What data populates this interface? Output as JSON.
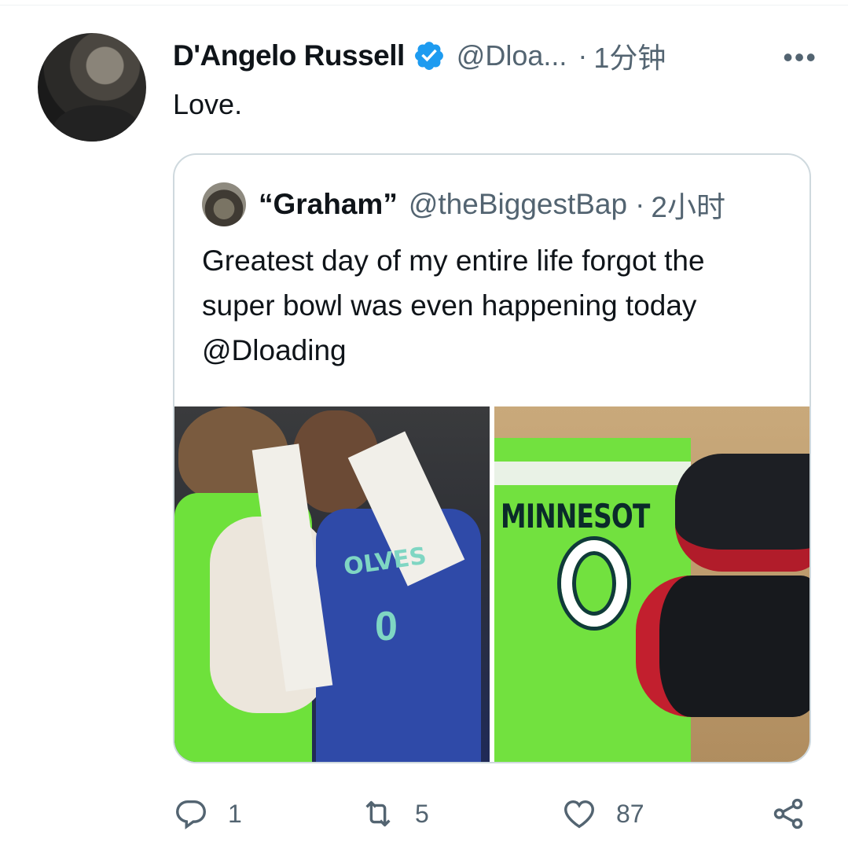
{
  "tweet": {
    "author_name": "D'Angelo Russell",
    "author_handle": "@Dloa...",
    "separator": "·",
    "time": "1分钟",
    "more": "•••",
    "text": "Love."
  },
  "quoted": {
    "author_name": "“Graham”",
    "author_handle": "@theBiggestBap",
    "separator": "·",
    "time": "2小时",
    "text_lines": [
      "Greatest day of my entire life forgot the",
      "super bowl was even happening today",
      "@Dloading"
    ],
    "photo_left": {
      "jersey_wordmark": "OLVES",
      "jersey_number": "0"
    },
    "photo_right": {
      "jersey_wordmark": "MINNESOT"
    }
  },
  "actions": {
    "reply_count": "1",
    "retweet_count": "5",
    "like_count": "87"
  },
  "colors": {
    "text": "#0f1419",
    "secondary": "#536471",
    "verified": "#1d9bf0",
    "border": "#cfd9de"
  },
  "icons": [
    "verified-badge-icon",
    "more-icon",
    "reply-icon",
    "retweet-icon",
    "like-icon",
    "share-icon"
  ]
}
